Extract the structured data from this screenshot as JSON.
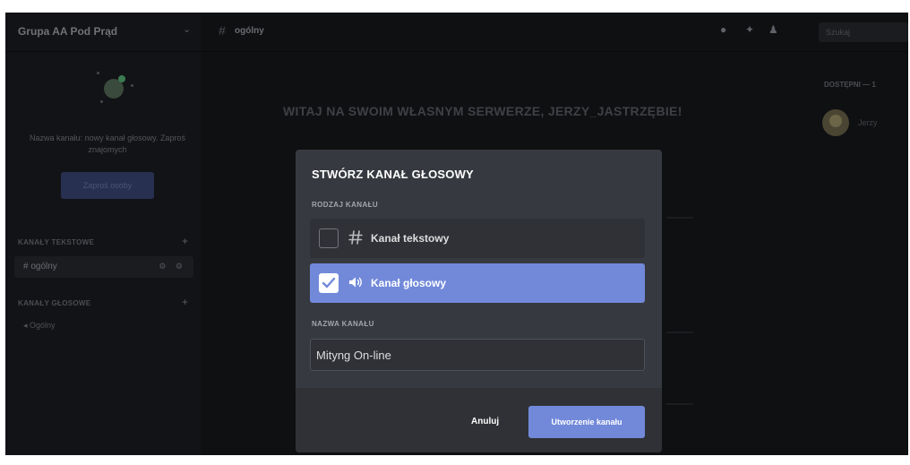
{
  "server": {
    "name": "Grupa AA Pod Prąd",
    "welcome_text": "Nazwa kanału: nowy kanał głosowy. Zaproś znajomych",
    "invite_label": "Zaproś osoby"
  },
  "sidebar": {
    "text_category": "KANAŁY TEKSTOWE",
    "text_channel": "ogólny",
    "voice_category": "KANAŁY GŁOSOWE",
    "voice_channel": "Ogólny"
  },
  "topbar": {
    "channel": "ogólny",
    "search_placeholder": "Szukaj"
  },
  "main": {
    "welcome_heading": "WITAJ NA SWOIM WŁASNYM SERWERZE, JERZY_JASTRZĘBIE!"
  },
  "members": {
    "heading": "DOSTĘPNI — 1",
    "member_name": "Jerzy"
  },
  "modal": {
    "title": "STWÓRZ KANAŁ GŁOSOWY",
    "channel_type_label": "RODZAJ KANAŁU",
    "options": [
      {
        "label": "Kanał tekstowy",
        "icon": "hash-icon",
        "checked": false
      },
      {
        "label": "Kanał głosowy",
        "icon": "speaker-icon",
        "checked": true
      }
    ],
    "channel_name_label": "NAZWA KANAŁU",
    "channel_name_value": "Mityng On-line",
    "cancel_label": "Anuluj",
    "create_label": "Utworzenie kanału"
  },
  "colors": {
    "accent": "#7289da",
    "modal_bg": "#36393f",
    "footer_bg": "#2f3136"
  }
}
